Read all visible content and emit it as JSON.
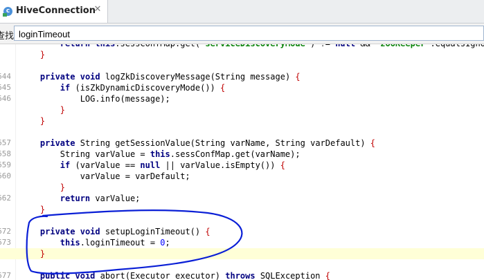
{
  "tab": {
    "icon_letter": "c",
    "title": "HiveConnection",
    "close_glyph": "✕"
  },
  "find": {
    "label": "查找:",
    "value": "loginTimeout"
  },
  "annotation_color": "#0a1fd6",
  "lines": [
    {
      "num": "",
      "parts": [
        [
          "",
          "        "
        ],
        [
          "kw",
          "return"
        ],
        [
          "",
          " "
        ],
        [
          "kw",
          "this"
        ],
        [
          "",
          ".sessConfMap.get("
        ],
        [
          "str",
          "\"serviceDiscoveryMode\""
        ],
        [
          "",
          ") != "
        ],
        [
          "kw",
          "null"
        ],
        [
          "",
          " && "
        ],
        [
          "str",
          "\"zooKeeper\""
        ],
        [
          "",
          ".equalsIgnoreC"
        ]
      ]
    },
    {
      "num": "",
      "parts": [
        [
          "brace",
          "    }"
        ]
      ]
    },
    {
      "num": "",
      "parts": []
    },
    {
      "num": "644",
      "parts": [
        [
          "",
          "    "
        ],
        [
          "kw",
          "private"
        ],
        [
          "",
          " "
        ],
        [
          "kw",
          "void"
        ],
        [
          "",
          " logZkDiscoveryMessage("
        ],
        [
          "cls",
          "String"
        ],
        [
          "",
          " message) "
        ],
        [
          "brace",
          "{"
        ]
      ]
    },
    {
      "num": "645",
      "parts": [
        [
          "",
          "        "
        ],
        [
          "kw",
          "if"
        ],
        [
          "",
          " (isZkDynamicDiscoveryMode()) "
        ],
        [
          "brace",
          "{"
        ]
      ]
    },
    {
      "num": "646",
      "parts": [
        [
          "",
          "            LOG.info(message);"
        ]
      ]
    },
    {
      "num": "",
      "parts": [
        [
          "brace",
          "        }"
        ]
      ]
    },
    {
      "num": "",
      "parts": [
        [
          "brace",
          "    }"
        ]
      ]
    },
    {
      "num": "",
      "parts": []
    },
    {
      "num": "657",
      "parts": [
        [
          "",
          "    "
        ],
        [
          "kw",
          "private"
        ],
        [
          "",
          " "
        ],
        [
          "cls",
          "String"
        ],
        [
          "",
          " getSessionValue("
        ],
        [
          "cls",
          "String"
        ],
        [
          "",
          " varName, "
        ],
        [
          "cls",
          "String"
        ],
        [
          "",
          " varDefault) "
        ],
        [
          "brace",
          "{"
        ]
      ]
    },
    {
      "num": "658",
      "parts": [
        [
          "",
          "        "
        ],
        [
          "cls",
          "String"
        ],
        [
          "",
          " varValue = "
        ],
        [
          "kw",
          "this"
        ],
        [
          "",
          ".sessConfMap.get(varName);"
        ]
      ]
    },
    {
      "num": "659",
      "parts": [
        [
          "",
          "        "
        ],
        [
          "kw",
          "if"
        ],
        [
          "",
          " (varValue == "
        ],
        [
          "kw",
          "null"
        ],
        [
          "",
          " || varValue.isEmpty()) "
        ],
        [
          "brace",
          "{"
        ]
      ]
    },
    {
      "num": "660",
      "parts": [
        [
          "",
          "            varValue = varDefault;"
        ]
      ]
    },
    {
      "num": "",
      "parts": [
        [
          "brace",
          "        }"
        ]
      ]
    },
    {
      "num": "662",
      "parts": [
        [
          "",
          "        "
        ],
        [
          "kw",
          "return"
        ],
        [
          "",
          " varValue;"
        ]
      ]
    },
    {
      "num": "",
      "parts": [
        [
          "brace",
          "    }"
        ]
      ]
    },
    {
      "num": "",
      "parts": []
    },
    {
      "num": "672",
      "parts": [
        [
          "",
          "    "
        ],
        [
          "kw",
          "private"
        ],
        [
          "",
          " "
        ],
        [
          "kw",
          "void"
        ],
        [
          "",
          " setupLoginTimeout() "
        ],
        [
          "brace",
          "{"
        ]
      ]
    },
    {
      "num": "673",
      "parts": [
        [
          "",
          "        "
        ],
        [
          "kw",
          "this"
        ],
        [
          "",
          ".loginTimeout = "
        ],
        [
          "num",
          "0"
        ],
        [
          "",
          ";"
        ]
      ]
    },
    {
      "num": "",
      "current": true,
      "parts": [
        [
          "brace",
          "    }"
        ]
      ]
    },
    {
      "num": "",
      "parts": []
    },
    {
      "num": "677",
      "parts": [
        [
          "",
          "    "
        ],
        [
          "kw",
          "public"
        ],
        [
          "",
          " "
        ],
        [
          "kw",
          "void"
        ],
        [
          "",
          " abort(Executor executor) "
        ],
        [
          "kw",
          "throws"
        ],
        [
          "",
          " SQLException "
        ],
        [
          "brace",
          "{"
        ]
      ]
    }
  ]
}
